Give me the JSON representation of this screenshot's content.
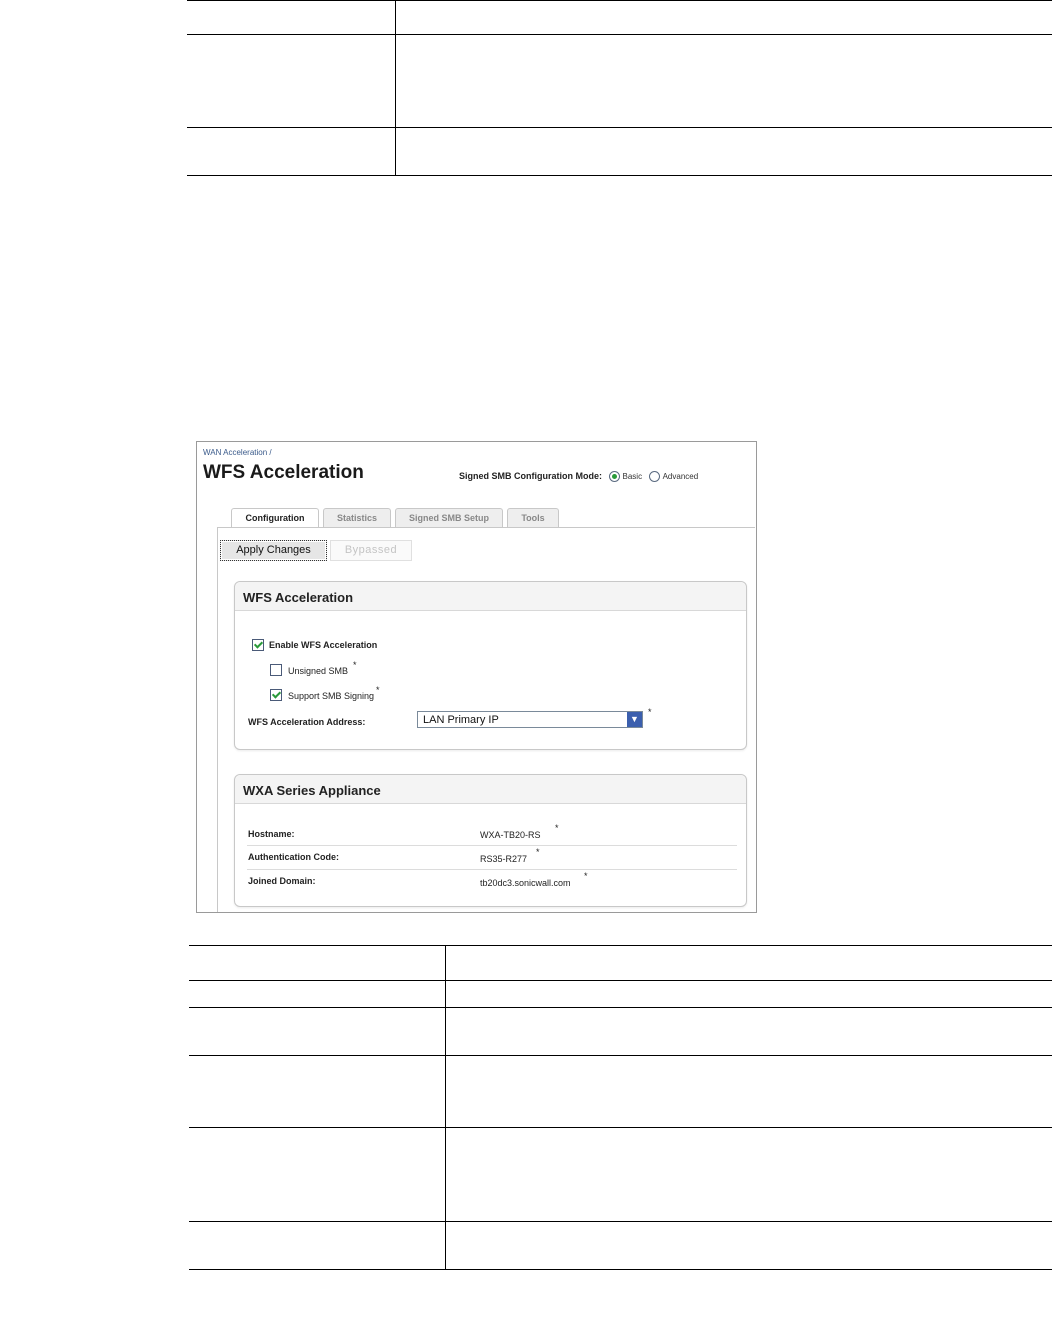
{
  "screenshot": {
    "breadcrumb": "WAN Acceleration /",
    "title": "WFS Acceleration",
    "mode_label": "Signed SMB Configuration Mode:",
    "mode_options": [
      "Basic",
      "Advanced"
    ],
    "mode_selected": "Basic",
    "tabs": [
      "Configuration",
      "Statistics",
      "Signed SMB Setup",
      "Tools"
    ],
    "active_tab": "Configuration",
    "apply_button": "Apply Changes",
    "bypass_button": "Bypassed",
    "wfs_panel": {
      "title": "WFS Acceleration",
      "enable_label": "Enable WFS Acceleration",
      "enable_checked": true,
      "unsigned_label": "Unsigned SMB",
      "unsigned_checked": false,
      "signing_label": "Support SMB Signing",
      "signing_checked": true,
      "address_label": "WFS Acceleration Address:",
      "address_value": "LAN Primary IP",
      "footnote_mark": "*"
    },
    "wxa_panel": {
      "title": "WXA Series Appliance",
      "rows": [
        {
          "label": "Hostname:",
          "value": "WXA-TB20-RS"
        },
        {
          "label": "Authentication Code:",
          "value": "RS35-R277"
        },
        {
          "label": "Joined Domain:",
          "value": "tb20dc3.sonicwall.com"
        }
      ]
    }
  }
}
